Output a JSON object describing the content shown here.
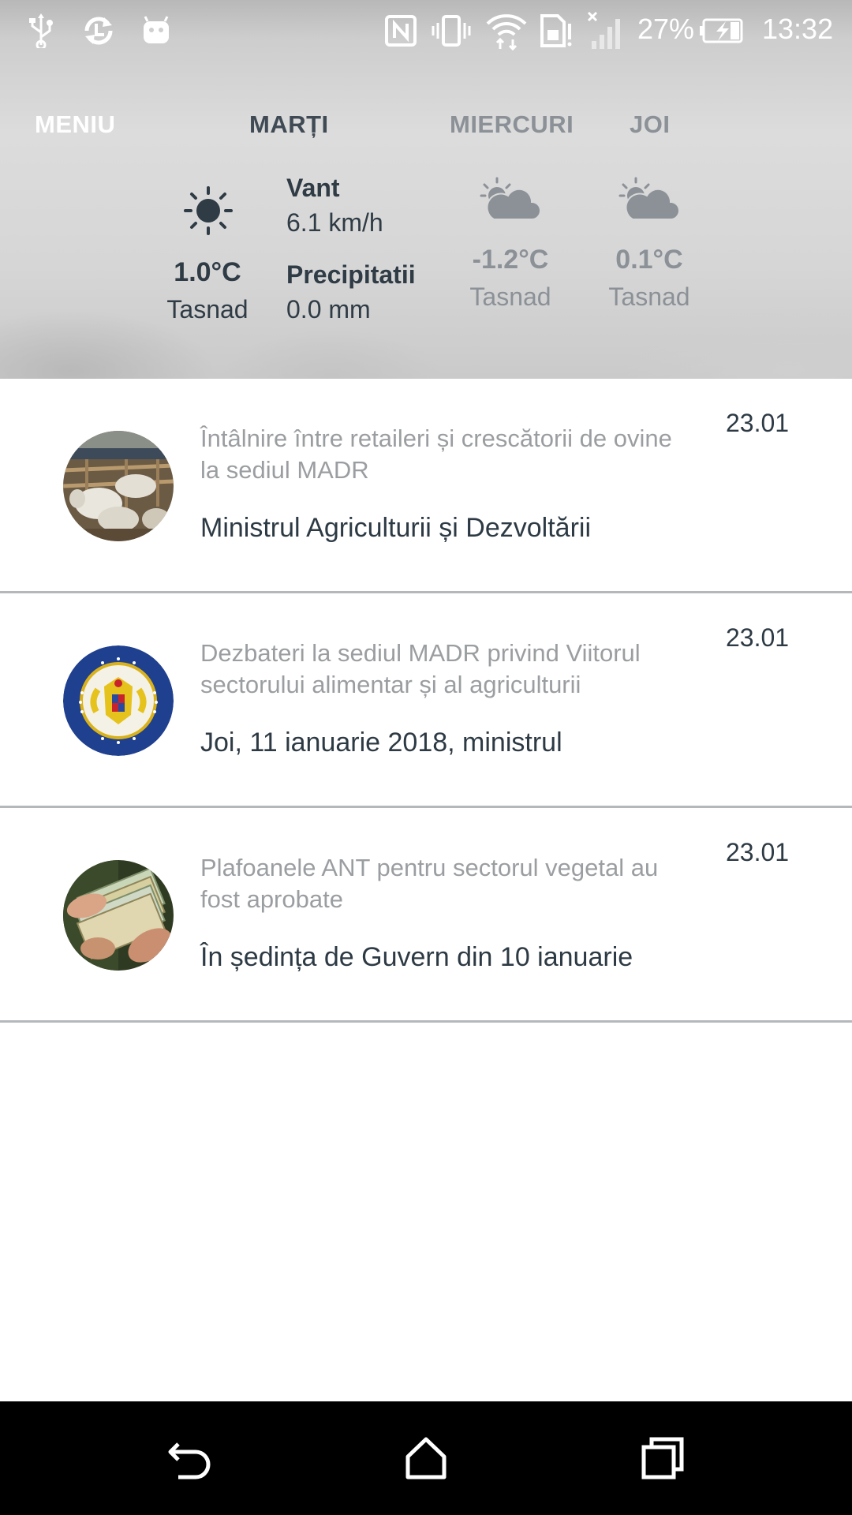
{
  "status_bar": {
    "battery_percent": "27%",
    "time": "13:32",
    "icons": [
      "usb-icon",
      "sync-icon",
      "android-icon",
      "nfc-icon",
      "vibrate-icon",
      "wifi-icon",
      "sim-alert-icon",
      "no-signal-icon",
      "battery-charging-icon"
    ]
  },
  "tabs": {
    "menu": "MENIU",
    "day1": "MARȚI",
    "day2": "MIERCURI",
    "day3": "JOI"
  },
  "weather": {
    "today": {
      "icon": "sun-icon",
      "temp": "1.0°C",
      "city": "Tasnad",
      "wind_label": "Vant",
      "wind_value": "6.1 km/h",
      "precip_label": "Precipitatii",
      "precip_value": "0.0 mm"
    },
    "day2": {
      "icon": "partly-cloudy-icon",
      "temp": "-1.2°C",
      "city": "Tasnad"
    },
    "day3": {
      "icon": "partly-cloudy-icon",
      "temp": "0.1°C",
      "city": "Tasnad"
    }
  },
  "news": [
    {
      "title": "Întâlnire între retaileri și crescătorii de ovine la sediul MADR",
      "subtitle": "Ministrul Agriculturii și Dezvoltării",
      "date": "23.01"
    },
    {
      "title": "Dezbateri la sediul MADR privind Viitorul sectorului alimentar și al agriculturii",
      "subtitle": "Joi, 11 ianuarie 2018, ministrul",
      "date": "23.01",
      "logo_text": "ROMÂNIA · MINISTERUL AGRICULTURII ȘI DEZVOLTĂRII RURALE"
    },
    {
      "title": "Plafoanele ANT pentru sectorul vegetal au fost aprobate",
      "subtitle": "În ședința de Guvern din 10 ianuarie",
      "date": "23.01"
    }
  ],
  "colors": {
    "accent_text": "#2d3a44",
    "muted_text": "#9b9ea1",
    "divider": "#b5b8bb",
    "navbar": "#000000"
  }
}
